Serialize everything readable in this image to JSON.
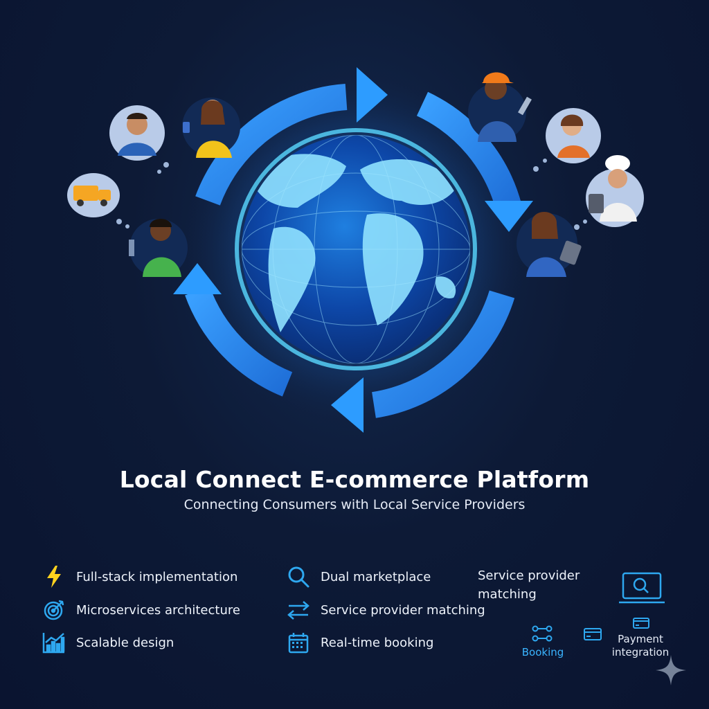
{
  "header": {
    "title": "Local Connect E-commerce Platform",
    "subtitle": "Connecting Consumers with Local Service Providers"
  },
  "features": {
    "left": [
      {
        "label": "Full-stack implementation",
        "icon": "lightning-icon"
      },
      {
        "label": "Microservices architecture",
        "icon": "target-icon"
      },
      {
        "label": "Scalable design",
        "icon": "bar-chart-icon"
      }
    ],
    "middle": [
      {
        "label": "Dual marketplace",
        "icon": "magnifier-icon"
      },
      {
        "label": "Service provider matching",
        "icon": "swap-arrows-icon"
      },
      {
        "label": "Real-time booking",
        "icon": "calendar-icon"
      }
    ]
  },
  "aside": {
    "text": "Service provider matching",
    "icon": "laptop-search-icon",
    "booking_label": "Booking",
    "payment_label": "Payment integration"
  },
  "colors": {
    "background": "#0d1a36",
    "accent": "#2ea8f0",
    "arrow": "#2b8ff0",
    "globe": "#4fd0ff",
    "lightning": "#ffd21e"
  }
}
